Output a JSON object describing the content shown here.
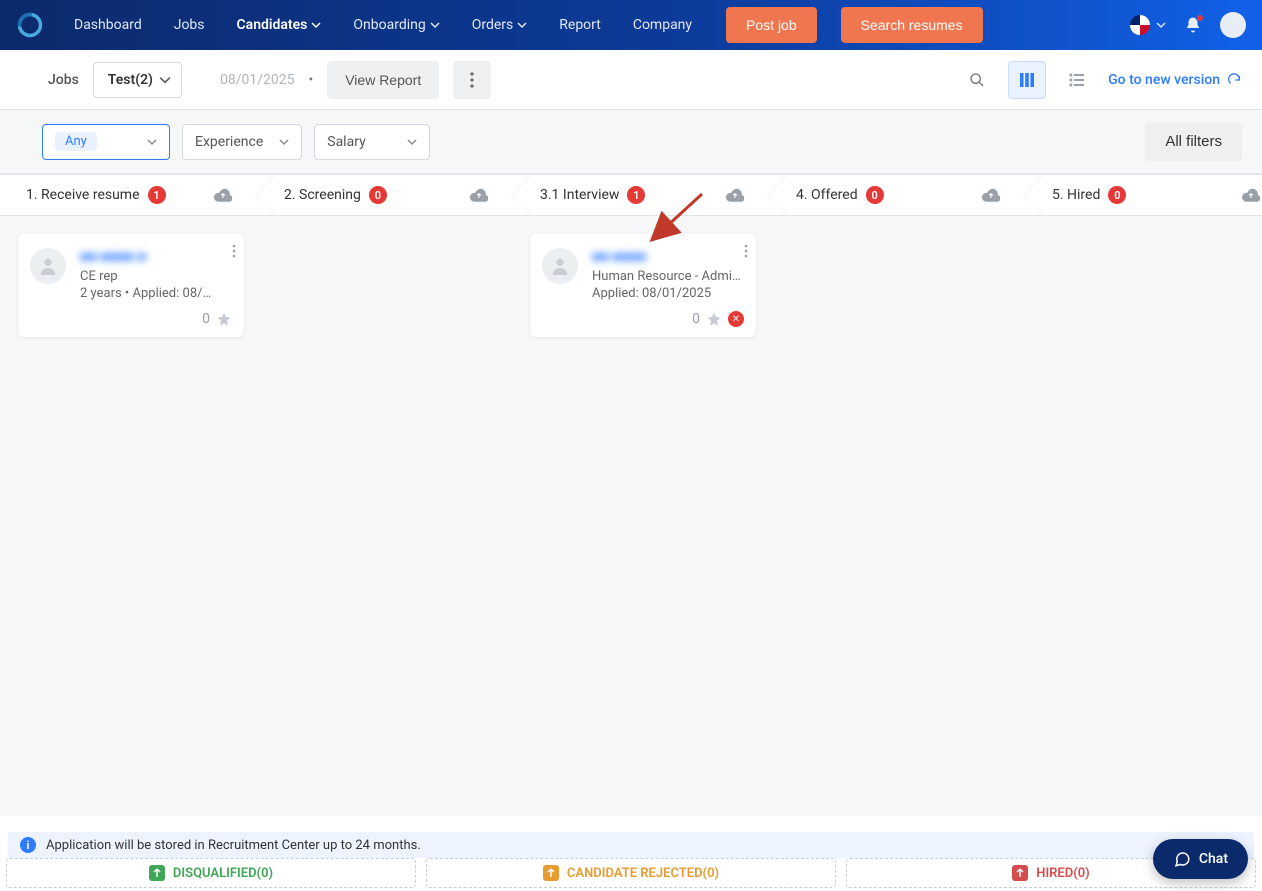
{
  "nav": {
    "items": [
      "Dashboard",
      "Jobs",
      "Candidates",
      "Onboarding",
      "Orders",
      "Report",
      "Company"
    ],
    "post_job": "Post job",
    "search_resumes": "Search resumes"
  },
  "subbar": {
    "jobs_label": "Jobs",
    "job_dd": "Test(2)",
    "date": "08/01/2025",
    "view_report": "View Report",
    "go_new": "Go to new version"
  },
  "filters": {
    "any": "Any",
    "experience": "Experience",
    "salary": "Salary",
    "all_filters": "All filters"
  },
  "stages": [
    {
      "label": "1. Receive resume",
      "count": "1"
    },
    {
      "label": "2. Screening",
      "count": "0"
    },
    {
      "label": "3.1 Interview",
      "count": "1"
    },
    {
      "label": "4. Offered",
      "count": "0"
    },
    {
      "label": "5. Hired",
      "count": "0"
    }
  ],
  "cards": {
    "c1": {
      "name": "■■ ■■■■ ■",
      "sub": "CE rep",
      "meta": "2 years  •  Applied: 08/…",
      "score": "0"
    },
    "c2": {
      "name": "■■ ■■■■",
      "sub": "Human Resource - Admin…",
      "meta": "Applied: 08/01/2025",
      "score": "0"
    }
  },
  "info_banner": "Application will be stored in Recruitment Center up to 24 months.",
  "buckets": {
    "disq": "DISQUALIFIED(0)",
    "rej": "CANDIDATE REJECTED(0)",
    "hired": "HIRED(0)"
  },
  "chat": "Chat"
}
